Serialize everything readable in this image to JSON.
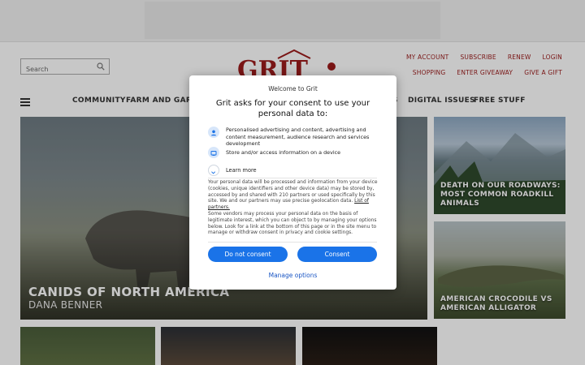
{
  "header": {
    "search_placeholder": "Search",
    "logo_text": "GRIT",
    "top_links_row1": [
      "MY ACCOUNT",
      "SUBSCRIBE",
      "RENEW",
      "LOGIN"
    ],
    "top_links_row2": [
      "SHOPPING",
      "ENTER GIVEAWAY",
      "GIVE A GIFT"
    ]
  },
  "nav": {
    "items": [
      "COMMUNITY",
      "FARM AND GARD",
      "S",
      "DIGITAL ISSUES",
      "FREE STUFF"
    ]
  },
  "feature": {
    "title": "CANIDS OF NORTH AMERICA",
    "author": "DANA BENNER"
  },
  "side_cards": [
    {
      "caption_line1": "DEATH ON OUR ROADWAYS:",
      "caption_line2": "MOST COMMON ROADKILL",
      "caption_line3": "ANIMALS"
    },
    {
      "caption_line1": "AMERICAN CROCODILE VS",
      "caption_line2": "AMERICAN ALLIGATOR"
    }
  ],
  "consent": {
    "welcome": "Welcome to Grit",
    "headline": "Grit asks for your consent to use your personal data to:",
    "purposes": [
      "Personalised advertising and content, advertising and content measurement, audience research and services development",
      "Store and/or access information on a device"
    ],
    "learn_more": "Learn more",
    "para1": "Your personal data will be processed and information from your device (cookies, unique identifiers and other device data) may be stored by, accessed by and shared with 210 partners or used specifically by this site. We and our partners may use precise geolocation data.",
    "partners_link": "List of partners.",
    "para2": "Some vendors may process your personal data on the basis of legitimate interest, which you can object to by managing your options below. Look for a link at the bottom of this page or in the site menu to manage or withdraw consent in privacy and cookie settings.",
    "reject_label": "Do not consent",
    "accept_label": "Consent",
    "manage_label": "Manage options"
  },
  "colors": {
    "brand_red": "#9b1b1b",
    "button_blue": "#1a73e8",
    "link_blue": "#1a56c4"
  }
}
